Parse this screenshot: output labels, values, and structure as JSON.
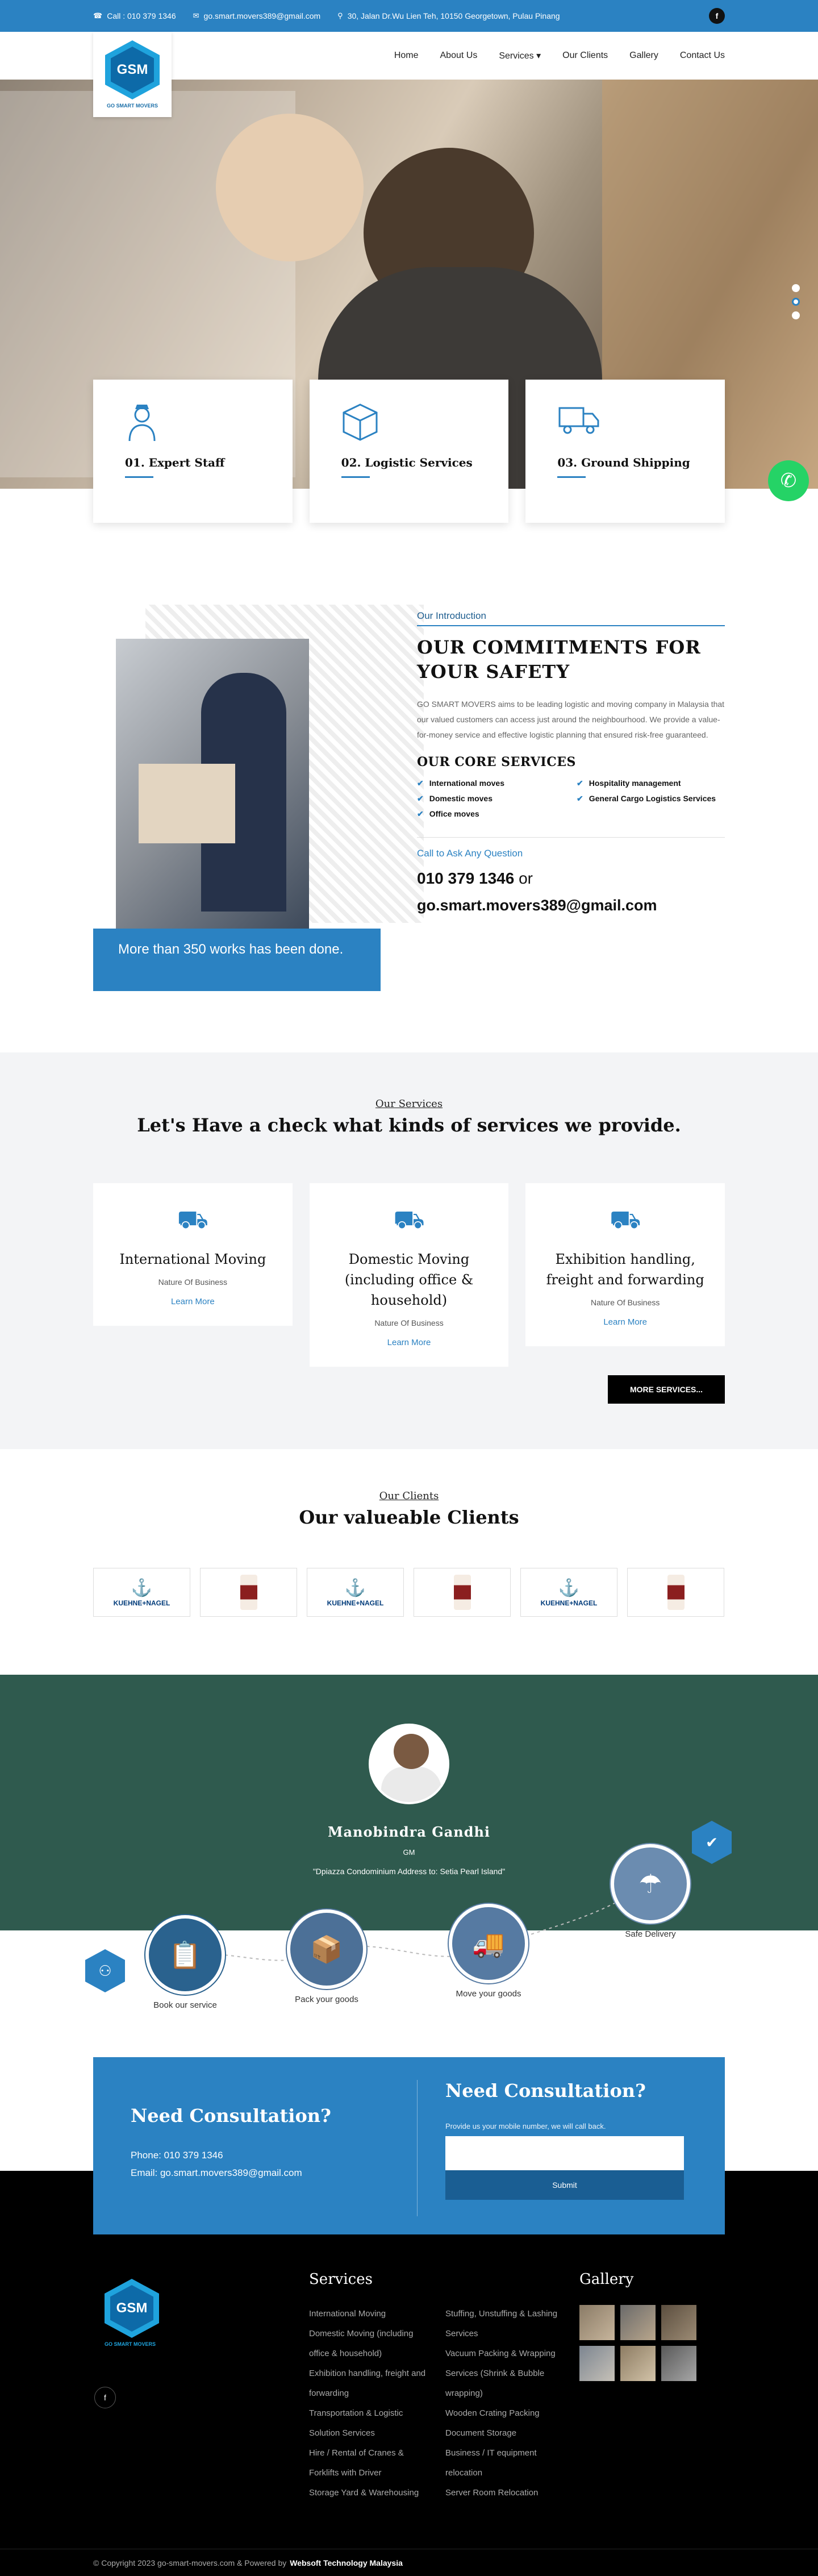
{
  "topbar": {
    "call": "Call : 010 379 1346",
    "email": "go.smart.movers389@gmail.com",
    "address": "30, Jalan Dr.Wu Lien Teh, 10150 Georgetown, Pulau Pinang",
    "facebook": "f"
  },
  "logo": {
    "mark": "GSM",
    "sub": "GO SMART MOVERS"
  },
  "nav": {
    "items": [
      "Home",
      "About Us",
      "Services ▾",
      "Our Clients",
      "Gallery",
      "Contact Us"
    ]
  },
  "features": [
    {
      "title": "01. Expert Staff",
      "icon": "staff-icon"
    },
    {
      "title": "02. Logistic Services",
      "icon": "box-icon"
    },
    {
      "title": "03. Ground Shipping",
      "icon": "truck-icon"
    }
  ],
  "intro": {
    "eyebrow": "Our Introduction",
    "title": "OUR COMMITMENTS FOR YOUR SAFETY",
    "body": "GO SMART MOVERS aims to be leading logistic and moving company in Malaysia that our valued customers can access just around the neighbourhood. We provide a value-for-money service and effective logistic planning that ensured risk-free guaranteed.",
    "core_title": "OUR CORE SERVICES",
    "core": [
      "International moves",
      "Hospitality management",
      "Domestic moves",
      "General Cargo Logistics Services",
      "Office moves"
    ],
    "works": "More than 350 works has been done.",
    "call_label": "Call to Ask Any Question",
    "phone": "010 379 1346",
    "or": "or",
    "email": "go.smart.movers389@gmail.com"
  },
  "services": {
    "eyebrow": "Our Services",
    "title": "Let's Have a check what kinds of services we provide.",
    "cards": [
      {
        "title": "International Moving",
        "nature": "Nature Of Business",
        "link": "Learn More"
      },
      {
        "title": "Domestic Moving (including office & household)",
        "nature": "Nature Of Business",
        "link": "Learn More"
      },
      {
        "title": "Exhibition handling, freight and forwarding",
        "nature": "Nature Of Business",
        "link": "Learn More"
      }
    ],
    "more": "MORE SERVICES..."
  },
  "clients": {
    "eyebrow": "Our Clients",
    "title": "Our valueable Clients",
    "logo_text": "KUEHNE+NAGEL"
  },
  "testimonial": {
    "name": "Manobindra Gandhi",
    "role": "GM",
    "quote": "\"Dpiazza Condominium Address to: Setia Pearl Island\""
  },
  "process": {
    "steps": [
      "Book our service",
      "Pack your goods",
      "Move your goods",
      "Safe Delivery"
    ]
  },
  "consult": {
    "left_title": "Need Consultation?",
    "phone": "Phone: 010 379 1346",
    "email": "Email: go.smart.movers389@gmail.com",
    "right_title": "Need Consultation?",
    "prompt": "Provide us your mobile number, we will call back.",
    "submit": "Submit"
  },
  "footer": {
    "services_title": "Services",
    "col1": [
      "International Moving",
      "Domestic Moving (including",
      "office & household)",
      "Exhibition handling, freight and",
      "forwarding",
      "Transportation & Logistic",
      "Solution Services",
      "Hire / Rental of Cranes &",
      "Forklifts with Driver",
      "Storage Yard & Warehousing"
    ],
    "col2": [
      "Stuffing, Unstuffing & Lashing",
      "Services",
      "Vacuum Packing & Wrapping",
      "Services (Shrink & Bubble",
      "wrapping)",
      "Wooden Crating Packing",
      "Document Storage",
      "Business / IT equipment",
      "relocation",
      "Server Room Relocation"
    ],
    "gallery_title": "Gallery",
    "facebook": "f"
  },
  "copyright": {
    "text": "© Copyright 2023 go-smart-movers.com & Powered by",
    "powered": "Websoft Technology Malaysia"
  }
}
